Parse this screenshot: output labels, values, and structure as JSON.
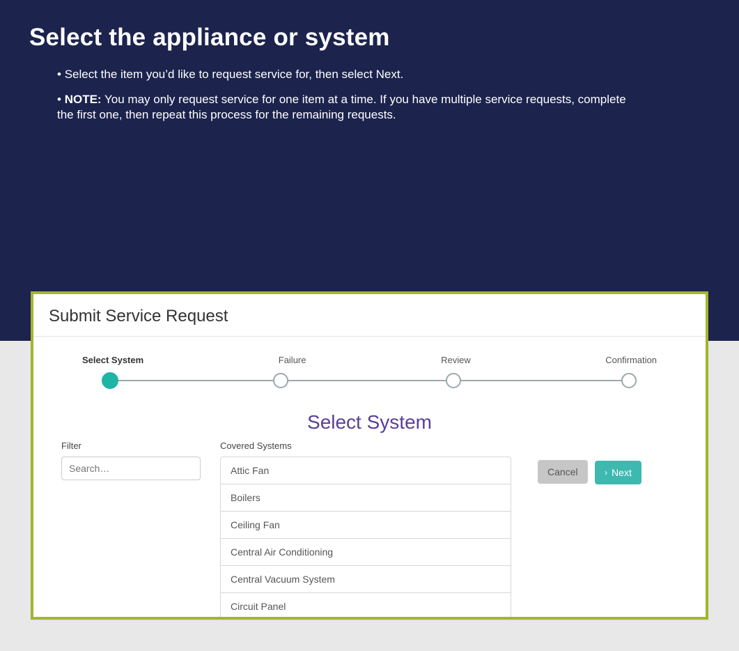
{
  "page": {
    "title": "Select the appliance or system",
    "bullet1": "Select the item you’d like to request service for, then select Next.",
    "note_label": "NOTE:",
    "note_text": " You may only request service for one item at a time. If you have multiple service requests, complete the first one, then repeat this process for the remaining requests."
  },
  "panel": {
    "title": "Submit Service Request",
    "steps": [
      "Select System",
      "Failure",
      "Review",
      "Confirmation"
    ],
    "active_step_index": 0,
    "heading": "Select System",
    "filter_label": "Filter",
    "search_placeholder": "Search…",
    "list_label": "Covered Systems",
    "systems": [
      "Attic Fan",
      "Boilers",
      "Ceiling Fan",
      "Central Air Conditioning",
      "Central Vacuum System",
      "Circuit Panel"
    ],
    "cancel_label": "Cancel",
    "next_label": "Next"
  },
  "colors": {
    "dark_bg": "#1c234d",
    "frame_border": "#a3b62c",
    "accent": "#1fb5a6",
    "heading_purple": "#5a3e99"
  }
}
